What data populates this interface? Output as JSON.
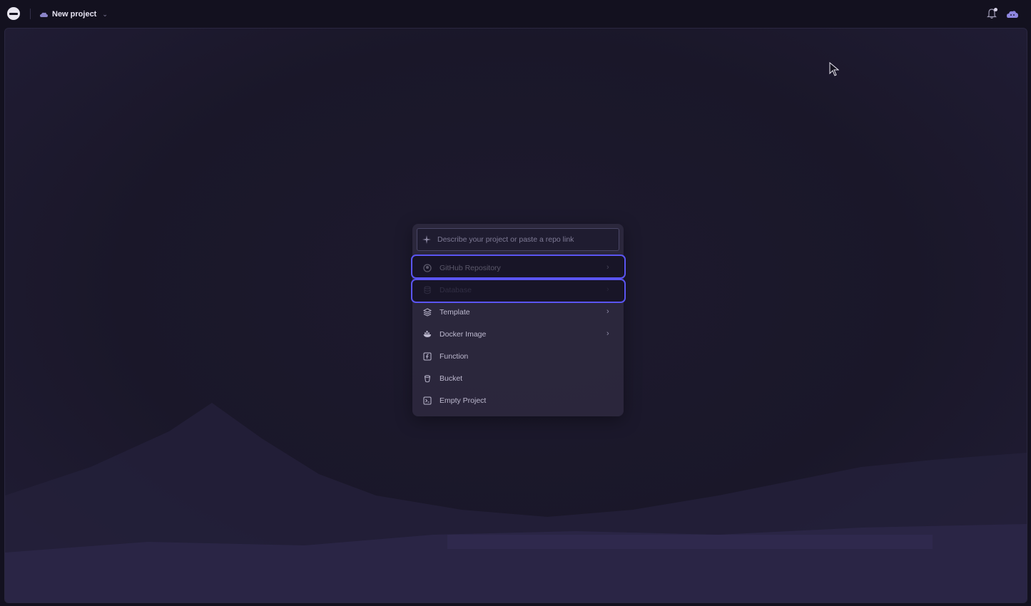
{
  "header": {
    "project_name": "New project",
    "icons": {
      "logo": "railway-logo-icon",
      "project": "project-cloud-icon",
      "dropdown": "chevron-down-icon",
      "notifications": "bell-icon",
      "avatar": "user-avatar-icon"
    }
  },
  "command_palette": {
    "search": {
      "placeholder": "Describe your project or paste a repo link",
      "value": "",
      "icon": "sparkle-icon"
    },
    "items": [
      {
        "label": "GitHub Repository",
        "icon": "github-icon",
        "has_submenu": true,
        "highlighted": true
      },
      {
        "label": "Database",
        "icon": "database-icon",
        "has_submenu": true,
        "highlighted": true,
        "dimmed": true
      },
      {
        "label": "Template",
        "icon": "layers-icon",
        "has_submenu": true
      },
      {
        "label": "Docker Image",
        "icon": "docker-icon",
        "has_submenu": true
      },
      {
        "label": "Function",
        "icon": "function-icon",
        "has_submenu": false
      },
      {
        "label": "Bucket",
        "icon": "bucket-icon",
        "has_submenu": false
      },
      {
        "label": "Empty Project",
        "icon": "terminal-icon",
        "has_submenu": false
      }
    ]
  },
  "colors": {
    "background": "#13111f",
    "panel": "#2c283e",
    "highlight_outline": "#5b55f2",
    "text": "#bdb9cf"
  }
}
